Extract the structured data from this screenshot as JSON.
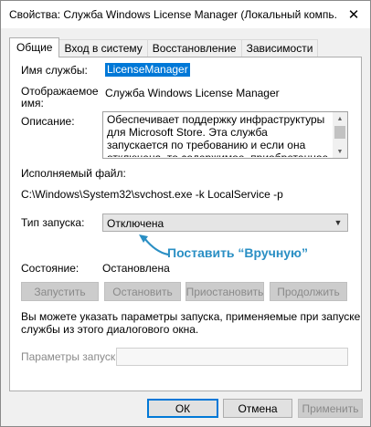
{
  "window": {
    "title": "Свойства: Служба Windows License Manager (Локальный компь...",
    "close_glyph": "✕"
  },
  "tabs": [
    {
      "label": "Общие"
    },
    {
      "label": "Вход в систему"
    },
    {
      "label": "Восстановление"
    },
    {
      "label": "Зависимости"
    }
  ],
  "general": {
    "service_name_label": "Имя службы:",
    "service_name_value": "LicenseManager",
    "display_name_label": "Отображаемое имя:",
    "display_name_value": "Служба Windows License Manager",
    "description_label": "Описание:",
    "description_value": "Обеспечивает поддержку инфраструктуры для Microsoft Store. Эта служба запускается по требованию и если она отключена, то содержимое, приобретенное в Microsoft Store, не будет работать.",
    "exe_label": "Исполняемый файл:",
    "exe_value": "C:\\Windows\\System32\\svchost.exe -k LocalService -p",
    "startup_label": "Тип запуска:",
    "startup_value": "Отключена",
    "annotation": "Поставить “Вручную”",
    "annotation_color": "#2a8fc4",
    "status_label": "Состояние:",
    "status_value": "Остановлена",
    "buttons": {
      "start": "Запустить",
      "stop": "Остановить",
      "pause": "Приостановить",
      "resume": "Продолжить"
    },
    "hint_line1": "Вы можете указать параметры запуска, применяемые при запуске",
    "hint_line2": "службы из этого диалогового окна.",
    "params_label": "Параметры запуска:",
    "params_value": ""
  },
  "footer": {
    "ok": "ОК",
    "cancel": "Отмена",
    "apply": "Применить"
  },
  "colors": {
    "selection": "#0078d7"
  }
}
